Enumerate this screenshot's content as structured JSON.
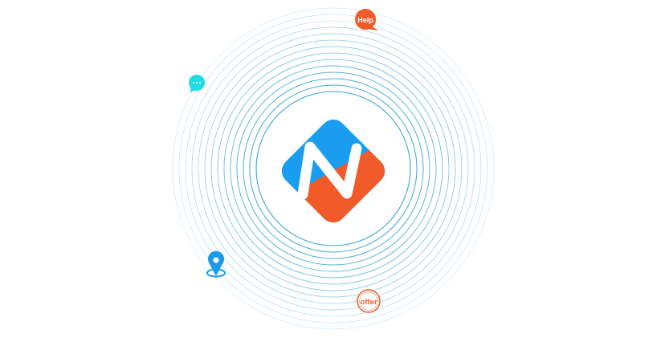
{
  "help_badge": {
    "label": "Help",
    "color": "#f15a29"
  },
  "offer_badge": {
    "label": "offer",
    "color": "#f15a29"
  },
  "chat_badge": {
    "icon": "chat-bubble-icon",
    "color": "#1fdde0"
  },
  "location_marker": {
    "icon": "map-pin-icon",
    "color": "#1a9be6"
  },
  "logo": {
    "icon": "n-diamond-logo",
    "top_color": "#1a9cf0",
    "bottom_color": "#f15a29"
  },
  "rings": {
    "color": "#3aa6d6"
  }
}
